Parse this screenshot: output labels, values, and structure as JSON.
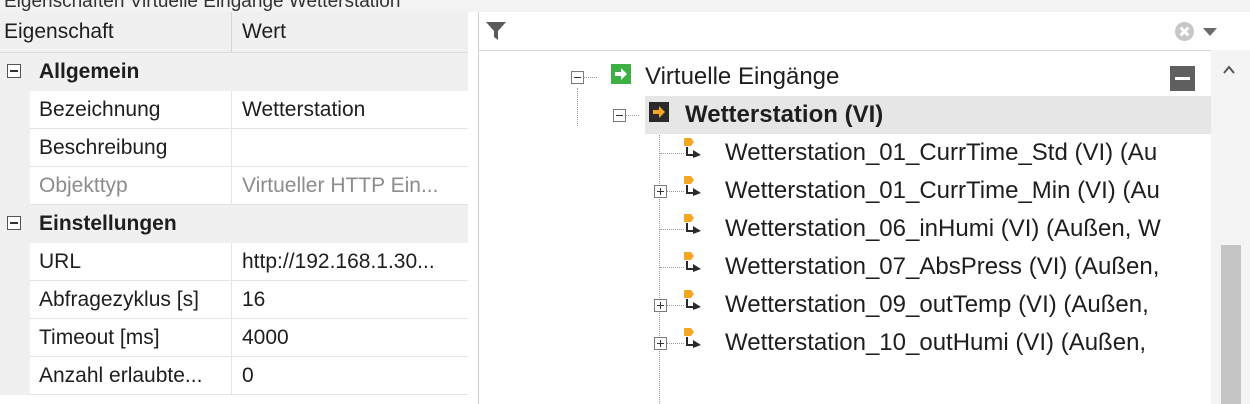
{
  "top_fragment": "Eigenschaften  Virtuelle Eingänge  Wetterstation",
  "properties": {
    "header": {
      "col_property": "Eigenschaft",
      "col_value": "Wert"
    },
    "categories": [
      {
        "label": "Allgemein",
        "rows": [
          {
            "name": "Bezeichnung",
            "value": "Wetterstation",
            "disabled": false
          },
          {
            "name": "Beschreibung",
            "value": "",
            "disabled": false
          },
          {
            "name": "Objekttyp",
            "value": "Virtueller HTTP Ein...",
            "disabled": true
          }
        ]
      },
      {
        "label": "Einstellungen",
        "rows": [
          {
            "name": "URL",
            "value": "http://192.168.1.30...",
            "disabled": false
          },
          {
            "name": "Abfragezyklus [s]",
            "value": "16",
            "disabled": false
          },
          {
            "name": "Timeout [ms]",
            "value": "4000",
            "disabled": false
          },
          {
            "name": "Anzahl erlaubte...",
            "value": "0",
            "disabled": false
          }
        ]
      }
    ]
  },
  "tree": {
    "filter": {
      "value": "",
      "placeholder": ""
    },
    "nodes": [
      {
        "label": "Virtuelle Eingänge",
        "expanded": true,
        "icon": "green-input-icon"
      },
      {
        "label": "Wetterstation (VI)",
        "expanded": true,
        "selected": true,
        "icon": "black-input-icon"
      },
      {
        "label": "Wetterstation_01_CurrTime_Std (VI) (Au",
        "has_children": false
      },
      {
        "label": "Wetterstation_01_CurrTime_Min (VI) (Au",
        "has_children": true
      },
      {
        "label": "Wetterstation_06_inHumi (VI) (Außen, W",
        "has_children": false
      },
      {
        "label": "Wetterstation_07_AbsPress (VI) (Außen,",
        "has_children": false
      },
      {
        "label": "Wetterstation_09_outTemp (VI) (Außen,",
        "has_children": true
      },
      {
        "label": "Wetterstation_10_outHumi (VI) (Außen,",
        "has_children": true
      }
    ]
  },
  "colors": {
    "green": "#3cb043",
    "orange": "#f5a623",
    "dark": "#2a2a2a"
  }
}
